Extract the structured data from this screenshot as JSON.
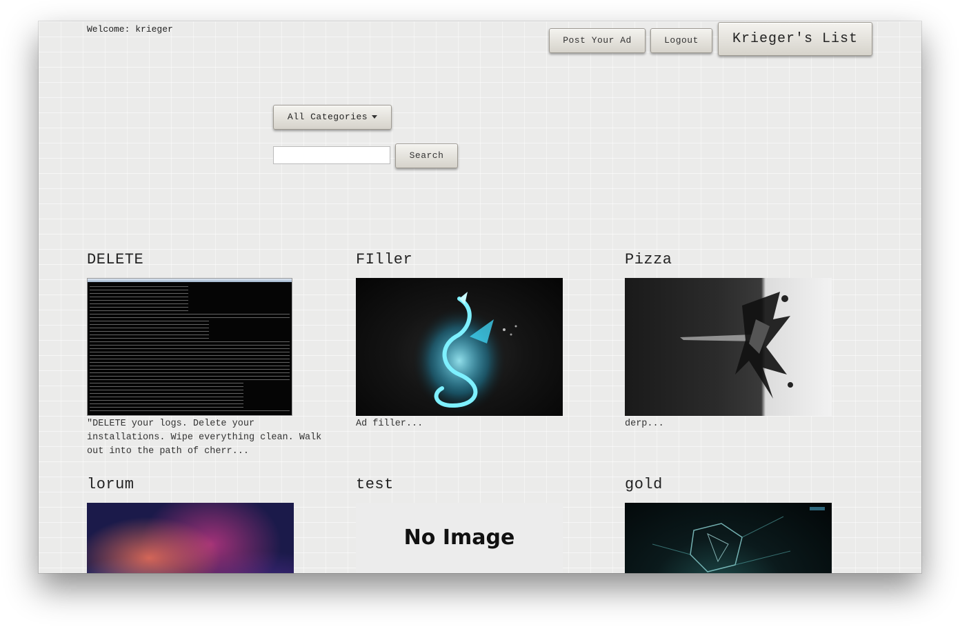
{
  "header": {
    "welcome": "Welcome: krieger",
    "post_ad_label": "Post Your Ad",
    "logout_label": "Logout",
    "brand_label": "Krieger's List"
  },
  "filters": {
    "category_label": "All Categories",
    "search_placeholder": "",
    "search_label": "Search"
  },
  "ads": [
    {
      "title": "DELETE",
      "description": "\"DELETE your logs. Delete your installations. Wipe everything clean. Walk out into the path of cherr..."
    },
    {
      "title": "FIller",
      "description": "Ad filler..."
    },
    {
      "title": "Pizza",
      "description": "derp..."
    },
    {
      "title": "lorum",
      "description": ""
    },
    {
      "title": "test",
      "description": "",
      "no_image_text": "No Image"
    },
    {
      "title": "gold",
      "description": ""
    }
  ]
}
